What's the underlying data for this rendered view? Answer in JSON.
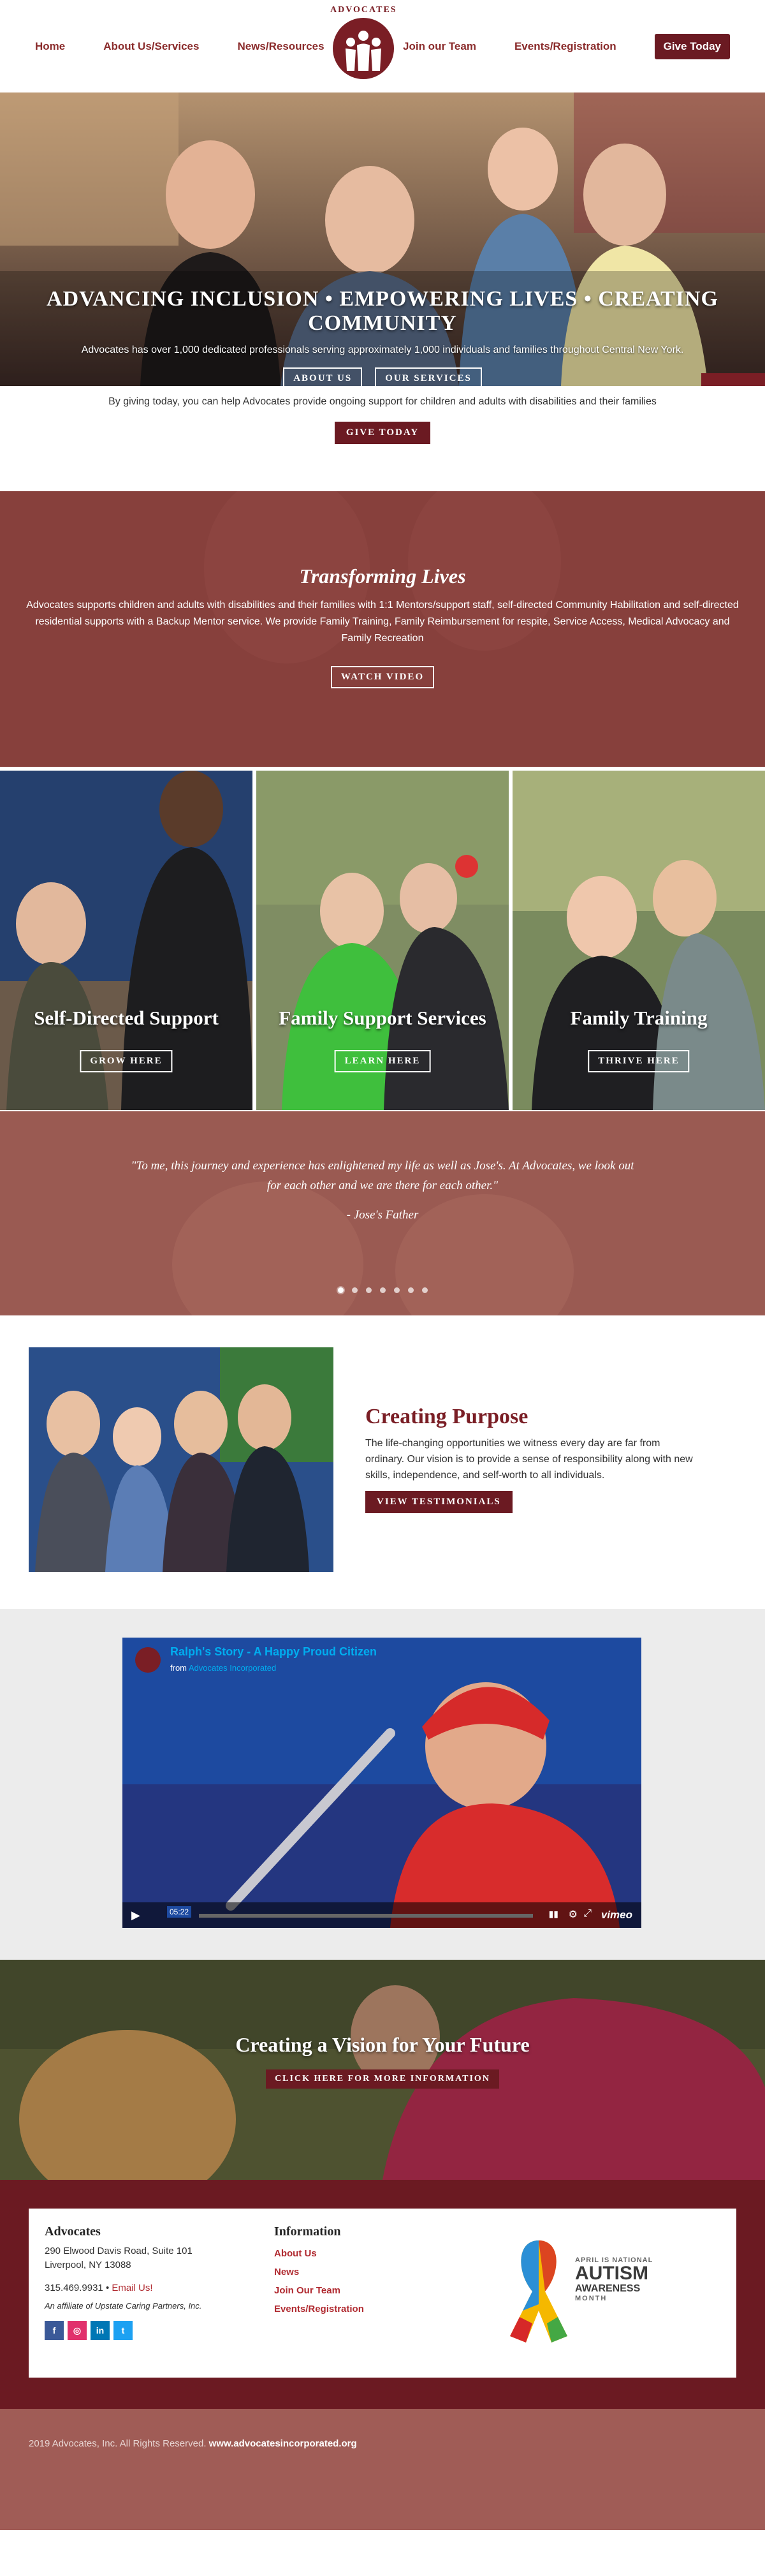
{
  "nav": {
    "left": [
      "Home",
      "About Us/Services",
      "News/Resources"
    ],
    "right": [
      "Join our Team",
      "Events/Registration"
    ],
    "give": "Give Today",
    "logo_text": "ADVOCATES"
  },
  "hero": {
    "title": "ADVANCING INCLUSION • EMPOWERING LIVES • CREATING COMMUNITY",
    "subtitle": "Advocates has over 1,000 dedicated professionals serving approximately 1,000 individuals and families throughout Central New York.",
    "btn_about": "ABOUT US",
    "btn_services": "OUR SERVICES"
  },
  "give_strip": {
    "text": "By giving today, you can help Advocates provide ongoing support for children and adults with disabilities and their families",
    "button": "GIVE TODAY"
  },
  "transform": {
    "title": "Transforming Lives",
    "text": "Advocates supports children and adults with disabilities and their families with 1:1 Mentors/support staff, self-directed Community Habilitation and self-directed residential supports with a Backup Mentor service. We provide Family Training, Family Reimbursement for respite, Service Access, Medical Advocacy and Family Recreation",
    "button": "WATCH VIDEO"
  },
  "tiles": [
    {
      "title": "Self-Directed Support",
      "button": "GROW HERE"
    },
    {
      "title": "Family Support Services",
      "button": "LEARN HERE"
    },
    {
      "title": "Family Training",
      "button": "THRIVE HERE"
    }
  ],
  "quote": {
    "text": "\"To me, this journey and experience has enlightened my life as well as Jose's. At Advocates, we look out for each other and we are there for each other.\"",
    "author": "- Jose's Father",
    "dot_count": 7,
    "active_dot": 0
  },
  "purpose": {
    "title": "Creating Purpose",
    "text": "The life-changing opportunities we witness every day are far from ordinary. Our vision is to provide a sense of responsibility along with new skills, independence, and self-worth to all individuals.",
    "button": "VIEW TESTIMONIALS"
  },
  "video": {
    "title": "Ralph's Story - A Happy Proud Citizen",
    "from_prefix": "from",
    "from_name": "Advocates Incorporated",
    "time": "05:22",
    "brand": "vimeo"
  },
  "vision": {
    "title": "Creating a Vision for Your Future",
    "button": "CLICK HERE FOR MORE INFORMATION"
  },
  "footer": {
    "org": "Advocates",
    "address1": "290 Elwood Davis Road, Suite 101",
    "address2": "Liverpool, NY 13088",
    "phone": "315.469.9931",
    "sep": "•",
    "email_label": "Email Us!",
    "affiliate": "An affiliate of Upstate Caring Partners, Inc.",
    "social": [
      {
        "icon": "facebook-icon",
        "glyph": "f",
        "color": "#3b5998"
      },
      {
        "icon": "instagram-icon",
        "glyph": "◎",
        "color": "#e1306c"
      },
      {
        "icon": "linkedin-icon",
        "glyph": "in",
        "color": "#0077b5"
      },
      {
        "icon": "twitter-icon",
        "glyph": "t",
        "color": "#1da1f2"
      }
    ],
    "info_head": "Information",
    "links": [
      "About Us",
      "News",
      "Join Our Team",
      "Events/Registration"
    ],
    "badge": {
      "small": "APRIL IS NATIONAL",
      "big": "AUTISM",
      "mid": "AWARENESS",
      "month": "MONTH"
    }
  },
  "copyright": {
    "text": "2019 Advocates, Inc. All Rights Reserved.",
    "site": "www.advocatesincorporated.org"
  },
  "colors": {
    "brand": "#6b1a22",
    "link": "#b02a30",
    "overlay": "#8e4a44"
  }
}
